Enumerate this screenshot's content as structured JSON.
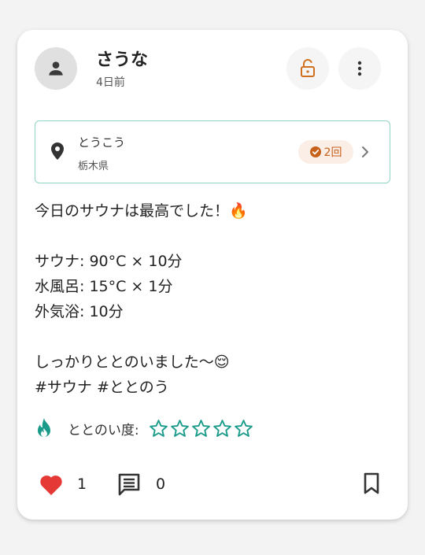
{
  "post": {
    "username": "さうな",
    "time_ago": "4日前",
    "location": {
      "name": "とうこう",
      "prefecture": "栃木県",
      "visit_count": "2回"
    },
    "body": "今日のサウナは最高でした！🔥\n\nサウナ: 90°C × 10分\n水風呂: 15°C × 1分\n外気浴: 10分\n\nしっかりととのいました〜😌\n#サウナ #ととのう",
    "rating_label": "ととのい度:",
    "rating": {
      "value": 0,
      "max": 5
    },
    "likes": "1",
    "comments": "0"
  },
  "colors": {
    "accent_teal": "#1a9b8a",
    "like_red": "#e53935",
    "lock_orange": "#d0701f",
    "badge_bg": "#fbeee6",
    "location_border": "#8fd4c4"
  },
  "icons": {
    "avatar": "person-icon",
    "lock": "unlock-icon",
    "more": "more-vert-icon",
    "location": "location-pin-icon",
    "visit": "check-circle-icon",
    "chevron": "chevron-right-icon",
    "rating": "flame-icon",
    "like": "heart-icon",
    "comment": "comment-icon",
    "bookmark": "bookmark-icon"
  }
}
